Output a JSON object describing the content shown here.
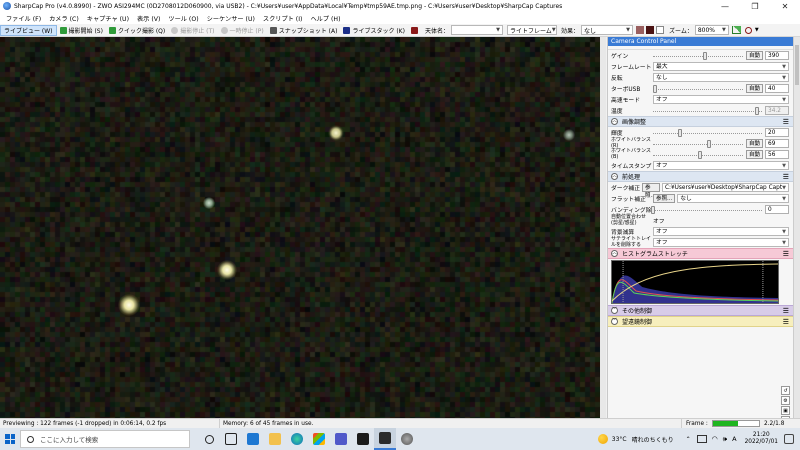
{
  "window": {
    "title": "SharpCap Pro (v4.0.8990) - ZWO ASI294MC (0D2708012D060900, via USB2) - C:¥Users¥user¥AppData¥Local¥Temp¥tmp59AE.tmp.png - C:¥Users¥user¥Desktop¥SharpCap Captures",
    "minimize": "—",
    "maximize": "❐",
    "close": "✕"
  },
  "menu": [
    "ファイル (F)",
    "カメラ (C)",
    "キャプチャ (U)",
    "表示 (V)",
    "ツール (O)",
    "シーケンサー (U)",
    "スクリプト (I)",
    "ヘルプ (H)"
  ],
  "toolbar": {
    "live_view": "ライブビュー (W)",
    "start_capture": "撮影開始 (S)",
    "quick_capture": "クイック撮影 (Q)",
    "stop_capture": "撮影停止 (T)",
    "pause": "一時停止 (P)",
    "snapshot": "スナップショット (A)",
    "live_stack": "ライブスタック (K)",
    "target_label": "天体名：",
    "target_value": "",
    "frame_type": "ライトフレーム",
    "effect_label": "効果：",
    "effect_value": "なし",
    "zoom_label": "ズーム：",
    "zoom_value": "800%"
  },
  "panel": {
    "title": "Camera Control Panel",
    "rows_top": [
      {
        "label": "ゲイン",
        "type": "slider",
        "pos": 0.58,
        "auto": "自動",
        "value": "390"
      },
      {
        "label": "フレームレート",
        "type": "select",
        "value": "最大"
      },
      {
        "label": "反転",
        "type": "select",
        "value": "なし"
      },
      {
        "label": "ターボUSB",
        "type": "slider",
        "pos": 0.02,
        "auto": "自動",
        "value": "40"
      },
      {
        "label": "高速モード",
        "type": "select",
        "value": "オフ"
      },
      {
        "label": "温度",
        "type": "slider",
        "pos": 0.95,
        "value": "34.2",
        "disabled": true
      }
    ],
    "section_image": "画像調整",
    "rows_image": [
      {
        "label": "輝度",
        "type": "slider",
        "pos": 0.25,
        "value": "20"
      },
      {
        "label": "ホワイトバランス(R)",
        "type": "slider",
        "pos": 0.62,
        "auto": "自動",
        "value": "69"
      },
      {
        "label": "ホワイトバランス(B)",
        "type": "slider",
        "pos": 0.52,
        "auto": "自動",
        "value": "56"
      },
      {
        "label": "タイムスタンプ",
        "type": "select",
        "value": "オフ"
      }
    ],
    "section_pre": "前処理",
    "rows_pre": [
      {
        "label": "ダーク補正",
        "type": "file",
        "browse": "参照...",
        "value": "C:¥Users¥user¥Desktop¥SharpCap Capt"
      },
      {
        "label": "フラット補正",
        "type": "file",
        "browse": "参照...",
        "value": "なし"
      },
      {
        "label": "バンディング除去",
        "type": "slider",
        "pos": 0.0,
        "value": "0"
      },
      {
        "label": "自動位置合わせ (剪星/惑星)",
        "type": "text",
        "value": "オフ"
      },
      {
        "label": "背景減算",
        "type": "select",
        "value": "オフ"
      },
      {
        "label": "サテライトトレイルを削除する",
        "type": "select",
        "value": "オフ"
      }
    ],
    "section_hist": "ヒストグラムストレッチ",
    "section_misc": "その他制御",
    "section_scope": "望遠鏡制御"
  },
  "status": {
    "preview": "Previewing : 122 frames (-1 dropped) in 0:06:14, 0.2 fps",
    "memory": "Memory: 6 of 45 frames in use.",
    "frame_label": "Frame :",
    "frame_fill": 0.55,
    "frame_value": "2.2/1.8"
  },
  "taskbar": {
    "search_placeholder": "ここに入力して検索",
    "temperature": "33°C",
    "weather": "晴れのちくもり",
    "time": "21:20",
    "date": "2022/07/01",
    "ime": "A"
  },
  "colors": {
    "accent": "#3a7bd5",
    "histogram": "#f6c9d6",
    "misc": "#d8cce8",
    "scope": "#f7efbd"
  }
}
